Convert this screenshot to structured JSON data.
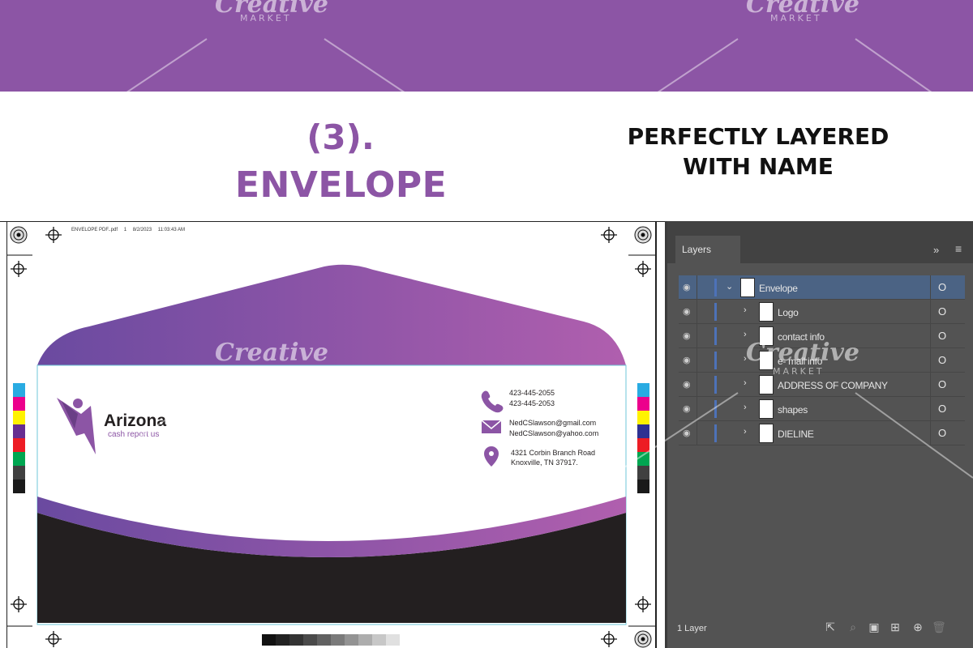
{
  "heading": {
    "number": "(3).",
    "word": "ENVELOPE",
    "tagline_line1": "PERFECTLY LAYERED",
    "tagline_line2": "WITH NAME"
  },
  "pdf_header": {
    "file": "ENVELOPE PDF..pdf",
    "page": "1",
    "date": "8/2/2023",
    "time": "11:03:43 AM"
  },
  "envelope": {
    "brand_name": "Arizona",
    "brand_tagline": "cash report us",
    "phone_1": "423-445-2055",
    "phone_2": "423-445-2053",
    "email_1": "NedCSlawson@gmail.com",
    "email_2": "NedCSlawson@yahoo.com",
    "address_1": "4321 Corbin Branch Road",
    "address_2": "Knoxville, TN 37917.",
    "colors": {
      "purple_start": "#6a4aa0",
      "purple_end": "#b05fae",
      "dark": "#231f20",
      "accent": "#8c55a5"
    }
  },
  "layers_panel": {
    "tab_label": "Layers",
    "expand_label": "»",
    "menu_label": "≡",
    "rows": [
      {
        "name": "Envelope",
        "chevron": "⌄",
        "target": "O"
      },
      {
        "name": "Logo",
        "chevron": "›",
        "target": "O"
      },
      {
        "name": "contact info",
        "chevron": "›",
        "target": "O"
      },
      {
        "name": "e- mail info",
        "chevron": "›",
        "target": "O"
      },
      {
        "name": "ADDRESS OF COMPANY",
        "chevron": "›",
        "target": "O"
      },
      {
        "name": "shapes",
        "chevron": "›",
        "target": "O"
      },
      {
        "name": "DIELINE",
        "chevron": "›",
        "target": "O"
      }
    ],
    "footer_count": "1 Layer"
  },
  "watermark": {
    "word": "Creative",
    "sub": "MARKET"
  },
  "colors": {
    "brand_purple": "#8c55a5",
    "panel_bg": "#535353",
    "panel_selected": "#4b6384"
  }
}
